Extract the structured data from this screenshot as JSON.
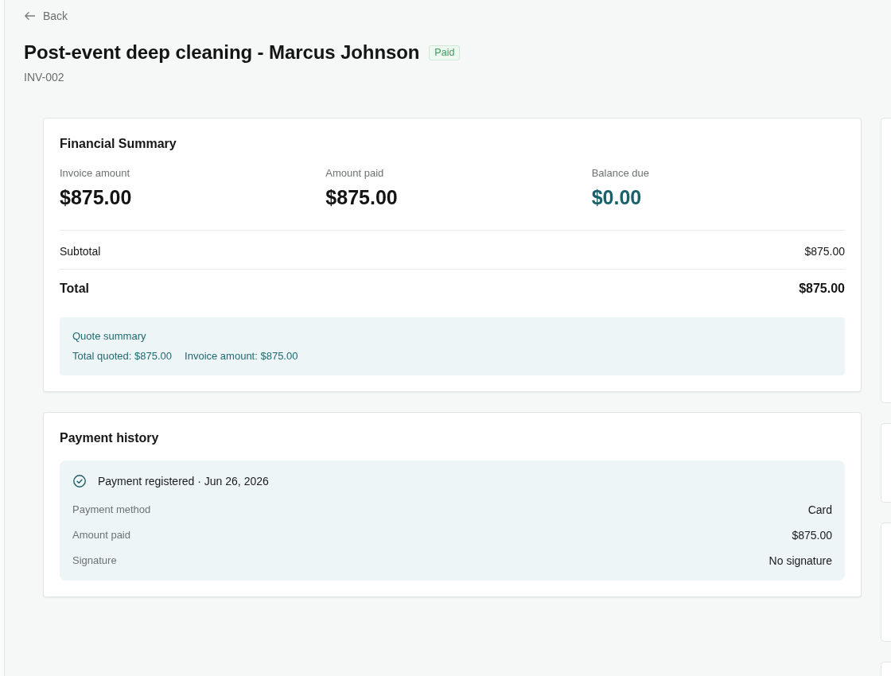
{
  "back_link": {
    "label": "Back"
  },
  "header": {
    "title": "Post-event deep cleaning - Marcus Johnson",
    "status": {
      "label": "Paid",
      "kind": "paid"
    },
    "invoice_number": "INV-002"
  },
  "financial_summary": {
    "title": "Financial Summary",
    "metrics": [
      {
        "label": "Invoice amount",
        "value": "$875.00",
        "kind": "amount"
      },
      {
        "label": "Amount paid",
        "value": "$875.00",
        "kind": "amount"
      },
      {
        "label": "Balance due",
        "value": "$0.00",
        "kind": "balance"
      }
    ],
    "lines": [
      {
        "label": "Subtotal",
        "value": "$875.00",
        "kind": "subtotal"
      },
      {
        "label": "Total",
        "value": "$875.00",
        "kind": "total"
      }
    ],
    "quote_summary": {
      "title": "Quote summary",
      "items": [
        "Total quoted: $875.00",
        "Invoice amount: $875.00"
      ]
    }
  },
  "payment_history": {
    "title": "Payment history",
    "payments": [
      {
        "heading": "Payment registered · Jun 26, 2026",
        "details": [
          {
            "label": "Payment method",
            "value": "Card"
          },
          {
            "label": "Amount paid",
            "value": "$875.00"
          },
          {
            "label": "Signature",
            "value": "No signature"
          }
        ]
      }
    ]
  }
}
